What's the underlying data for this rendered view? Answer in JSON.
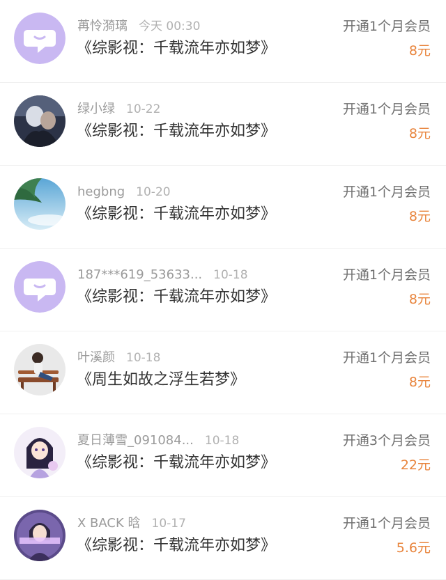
{
  "colors": {
    "accent": "#e8843c",
    "avatar_default_bg": "#c9b8f2"
  },
  "items": [
    {
      "avatar": "default-chat-icon",
      "name": "苒怜漪璃",
      "time": "今天 00:30",
      "title": "《综影视：千载流年亦如梦》",
      "plan": "开通1个月会员",
      "price": "8元"
    },
    {
      "avatar": "photo-people",
      "name": "绿小绿",
      "time": "10-22",
      "title": "《综影视：千载流年亦如梦》",
      "plan": "开通1个月会员",
      "price": "8元"
    },
    {
      "avatar": "photo-palm-sky",
      "name": "hegbng",
      "time": "10-20",
      "title": "《综影视：千载流年亦如梦》",
      "plan": "开通1个月会员",
      "price": "8元"
    },
    {
      "avatar": "default-chat-icon",
      "name": "187***619_53633...",
      "time": "10-18",
      "title": "《综影视：千载流年亦如梦》",
      "plan": "开通1个月会员",
      "price": "8元"
    },
    {
      "avatar": "illustration-bench",
      "name": "叶溪颜",
      "time": "10-18",
      "title": "《周生如故之浮生若梦》",
      "plan": "开通1个月会员",
      "price": "8元"
    },
    {
      "avatar": "illustration-anime-girl",
      "name": "夏日薄雪_091084...",
      "time": "10-18",
      "title": "《综影视：千载流年亦如梦》",
      "plan": "开通3个月会员",
      "price": "22元"
    },
    {
      "avatar": "illustration-purple-portrait",
      "name": "X BACK 晗",
      "time": "10-17",
      "title": "《综影视：千载流年亦如梦》",
      "plan": "开通1个月会员",
      "price": "5.6元"
    }
  ]
}
